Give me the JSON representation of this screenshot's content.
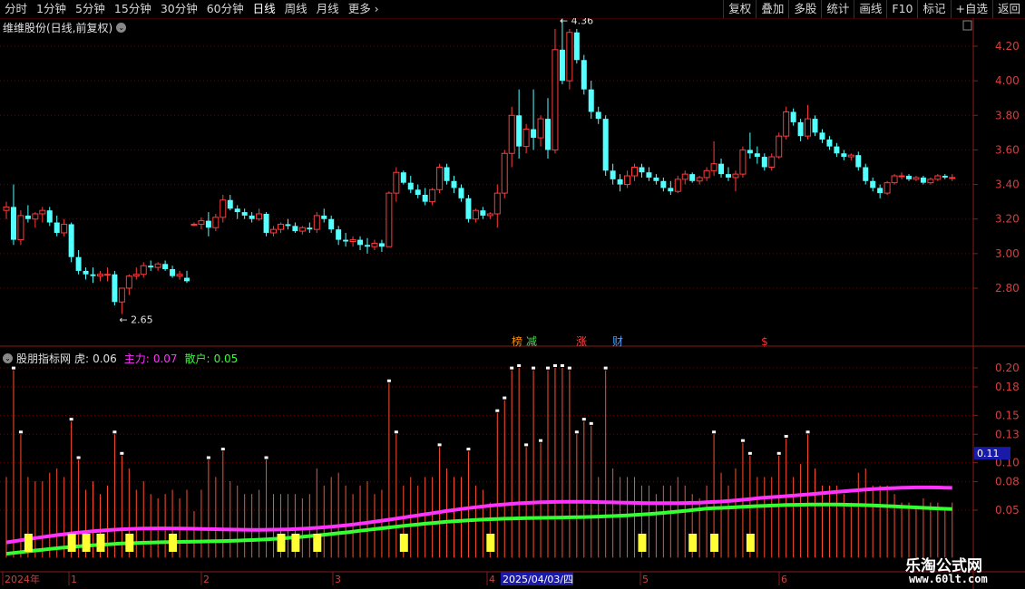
{
  "toolbar": {
    "periods": [
      "分时",
      "1分钟",
      "5分钟",
      "15分钟",
      "30分钟",
      "60分钟",
      "日线",
      "周线",
      "月线",
      "更多"
    ],
    "active_period": "日线",
    "right_buttons": [
      "复权",
      "叠加",
      "多股",
      "统计",
      "画线",
      "F10",
      "标记",
      "+自选",
      "返回"
    ]
  },
  "price_panel": {
    "title": "维维股份(日线,前复权)",
    "high_label": "4.36",
    "low_label": "2.65",
    "y_ticks": [
      "4.20",
      "4.00",
      "3.80",
      "3.60",
      "3.40",
      "3.20",
      "3.00",
      "2.80"
    ],
    "markers": [
      {
        "text": "榜",
        "color": "#ff8c00"
      },
      {
        "text": "减",
        "color": "#4cd94c"
      },
      {
        "text": "涨",
        "color": "#ff4040"
      },
      {
        "text": "财",
        "color": "#4a9eff"
      },
      {
        "text": "$",
        "color": "#ff3030"
      }
    ]
  },
  "indicator_panel": {
    "name": "股朋指标网",
    "label_tiger": "虎:",
    "value_tiger": "0.06",
    "label_main": "主力:",
    "value_main": "0.07",
    "label_retail": "散户:",
    "value_retail": "0.05",
    "y_ticks": [
      "0.20",
      "0.18",
      "0.15",
      "0.13",
      "0.10",
      "0.08",
      "0.05"
    ],
    "current_value": "0.11",
    "colors": {
      "main": "#ff33ff",
      "retail": "#33ff33",
      "bars": "#ff4d2e",
      "signal": "#ffff33"
    }
  },
  "date_axis": {
    "labels": [
      "2024年",
      "1",
      "2",
      "3",
      "4",
      "5",
      "6"
    ],
    "highlight": "2025/04/03/四"
  },
  "watermark": {
    "line1": "乐淘公式网",
    "line2": "www.60lt.com"
  },
  "chart_data": {
    "type": "candlestick",
    "title": "维维股份(日线,前复权)",
    "ylim": [
      2.6,
      4.4
    ],
    "candles": [
      [
        3.25,
        3.3,
        3.2,
        3.27
      ],
      [
        3.27,
        3.4,
        3.05,
        3.08
      ],
      [
        3.08,
        3.25,
        3.05,
        3.22
      ],
      [
        3.22,
        3.28,
        3.18,
        3.2
      ],
      [
        3.2,
        3.24,
        3.15,
        3.23
      ],
      [
        3.23,
        3.27,
        3.18,
        3.25
      ],
      [
        3.25,
        3.27,
        3.16,
        3.18
      ],
      [
        3.18,
        3.22,
        3.1,
        3.12
      ],
      [
        3.12,
        3.2,
        3.1,
        3.17
      ],
      [
        3.17,
        3.18,
        2.95,
        2.98
      ],
      [
        2.98,
        3.02,
        2.88,
        2.9
      ],
      [
        2.9,
        2.92,
        2.85,
        2.88
      ],
      [
        2.88,
        2.92,
        2.83,
        2.87
      ],
      [
        2.87,
        2.9,
        2.84,
        2.88
      ],
      [
        2.88,
        2.92,
        2.84,
        2.88
      ],
      [
        2.88,
        2.9,
        2.7,
        2.72
      ],
      [
        2.72,
        2.8,
        2.65,
        2.8
      ],
      [
        2.8,
        2.88,
        2.76,
        2.87
      ],
      [
        2.87,
        2.92,
        2.85,
        2.88
      ],
      [
        2.88,
        2.95,
        2.86,
        2.93
      ],
      [
        2.93,
        2.96,
        2.9,
        2.92
      ],
      [
        2.92,
        2.95,
        2.9,
        2.94
      ],
      [
        2.94,
        2.96,
        2.9,
        2.91
      ],
      [
        2.91,
        2.93,
        2.86,
        2.87
      ],
      [
        2.87,
        2.9,
        2.85,
        2.88
      ],
      [
        2.86,
        2.9,
        2.83,
        2.84
      ],
      [
        3.17,
        3.18,
        3.16,
        3.17
      ],
      [
        3.17,
        3.21,
        3.14,
        3.19
      ],
      [
        3.19,
        3.24,
        3.1,
        3.15
      ],
      [
        3.15,
        3.23,
        3.13,
        3.21
      ],
      [
        3.21,
        3.34,
        3.18,
        3.31
      ],
      [
        3.31,
        3.34,
        3.25,
        3.26
      ],
      [
        3.26,
        3.28,
        3.2,
        3.24
      ],
      [
        3.24,
        3.26,
        3.2,
        3.22
      ],
      [
        3.22,
        3.24,
        3.18,
        3.2
      ],
      [
        3.2,
        3.26,
        3.19,
        3.23
      ],
      [
        3.23,
        3.24,
        3.1,
        3.12
      ],
      [
        3.12,
        3.16,
        3.1,
        3.14
      ],
      [
        3.14,
        3.18,
        3.12,
        3.17
      ],
      [
        3.17,
        3.2,
        3.14,
        3.16
      ],
      [
        3.16,
        3.18,
        3.12,
        3.13
      ],
      [
        3.13,
        3.16,
        3.11,
        3.15
      ],
      [
        3.15,
        3.18,
        3.12,
        3.14
      ],
      [
        3.14,
        3.24,
        3.12,
        3.22
      ],
      [
        3.22,
        3.26,
        3.18,
        3.2
      ],
      [
        3.2,
        3.22,
        3.12,
        3.14
      ],
      [
        3.14,
        3.16,
        3.05,
        3.08
      ],
      [
        3.08,
        3.12,
        3.04,
        3.07
      ],
      [
        3.07,
        3.1,
        3.04,
        3.08
      ],
      [
        3.08,
        3.1,
        3.02,
        3.05
      ],
      [
        3.05,
        3.09,
        3.0,
        3.04
      ],
      [
        3.04,
        3.08,
        3.02,
        3.06
      ],
      [
        3.06,
        3.08,
        3.01,
        3.04
      ],
      [
        3.04,
        3.36,
        3.04,
        3.35
      ],
      [
        3.35,
        3.5,
        3.3,
        3.47
      ],
      [
        3.47,
        3.48,
        3.4,
        3.41
      ],
      [
        3.41,
        3.45,
        3.35,
        3.37
      ],
      [
        3.37,
        3.4,
        3.32,
        3.34
      ],
      [
        3.34,
        3.38,
        3.28,
        3.3
      ],
      [
        3.3,
        3.38,
        3.28,
        3.37
      ],
      [
        3.37,
        3.52,
        3.35,
        3.5
      ],
      [
        3.5,
        3.52,
        3.4,
        3.42
      ],
      [
        3.42,
        3.45,
        3.35,
        3.38
      ],
      [
        3.38,
        3.4,
        3.3,
        3.32
      ],
      [
        3.32,
        3.34,
        3.18,
        3.2
      ],
      [
        3.2,
        3.26,
        3.18,
        3.25
      ],
      [
        3.25,
        3.27,
        3.2,
        3.22
      ],
      [
        3.22,
        3.24,
        3.2,
        3.23
      ],
      [
        3.23,
        3.4,
        3.15,
        3.35
      ],
      [
        3.35,
        3.6,
        3.32,
        3.58
      ],
      [
        3.58,
        3.85,
        3.5,
        3.8
      ],
      [
        3.8,
        3.95,
        3.55,
        3.62
      ],
      [
        3.62,
        3.75,
        3.58,
        3.72
      ],
      [
        3.72,
        3.95,
        3.6,
        3.67
      ],
      [
        3.67,
        3.8,
        3.62,
        3.78
      ],
      [
        3.78,
        3.9,
        3.55,
        3.6
      ],
      [
        3.6,
        4.3,
        3.58,
        4.18
      ],
      [
        4.18,
        4.36,
        3.98,
        4.0
      ],
      [
        4.0,
        4.3,
        3.95,
        4.28
      ],
      [
        4.28,
        4.3,
        4.1,
        4.12
      ],
      [
        4.12,
        4.15,
        3.92,
        3.95
      ],
      [
        3.95,
        4.0,
        3.78,
        3.82
      ],
      [
        3.82,
        3.85,
        3.75,
        3.78
      ],
      [
        3.78,
        3.8,
        3.45,
        3.48
      ],
      [
        3.48,
        3.52,
        3.4,
        3.43
      ],
      [
        3.43,
        3.46,
        3.36,
        3.4
      ],
      [
        3.4,
        3.48,
        3.38,
        3.45
      ],
      [
        3.45,
        3.52,
        3.42,
        3.5
      ],
      [
        3.5,
        3.52,
        3.44,
        3.47
      ],
      [
        3.47,
        3.5,
        3.42,
        3.44
      ],
      [
        3.44,
        3.46,
        3.4,
        3.42
      ],
      [
        3.42,
        3.44,
        3.36,
        3.38
      ],
      [
        3.38,
        3.42,
        3.34,
        3.36
      ],
      [
        3.36,
        3.45,
        3.35,
        3.43
      ],
      [
        3.43,
        3.48,
        3.4,
        3.46
      ],
      [
        3.46,
        3.47,
        3.41,
        3.42
      ],
      [
        3.42,
        3.45,
        3.4,
        3.44
      ],
      [
        3.44,
        3.5,
        3.42,
        3.48
      ],
      [
        3.48,
        3.65,
        3.45,
        3.52
      ],
      [
        3.52,
        3.55,
        3.44,
        3.46
      ],
      [
        3.46,
        3.5,
        3.42,
        3.44
      ],
      [
        3.44,
        3.48,
        3.36,
        3.46
      ],
      [
        3.46,
        3.62,
        3.44,
        3.6
      ],
      [
        3.6,
        3.7,
        3.55,
        3.58
      ],
      [
        3.58,
        3.62,
        3.52,
        3.56
      ],
      [
        3.56,
        3.58,
        3.48,
        3.5
      ],
      [
        3.5,
        3.58,
        3.48,
        3.56
      ],
      [
        3.56,
        3.7,
        3.55,
        3.68
      ],
      [
        3.68,
        3.85,
        3.66,
        3.82
      ],
      [
        3.82,
        3.84,
        3.74,
        3.76
      ],
      [
        3.76,
        3.78,
        3.65,
        3.68
      ],
      [
        3.68,
        3.86,
        3.66,
        3.78
      ],
      [
        3.78,
        3.8,
        3.68,
        3.7
      ],
      [
        3.7,
        3.72,
        3.64,
        3.66
      ],
      [
        3.66,
        3.68,
        3.6,
        3.62
      ],
      [
        3.62,
        3.64,
        3.56,
        3.58
      ],
      [
        3.58,
        3.6,
        3.54,
        3.56
      ],
      [
        3.56,
        3.58,
        3.54,
        3.57
      ],
      [
        3.57,
        3.59,
        3.48,
        3.5
      ],
      [
        3.5,
        3.52,
        3.4,
        3.42
      ],
      [
        3.42,
        3.44,
        3.36,
        3.38
      ],
      [
        3.38,
        3.4,
        3.32,
        3.35
      ],
      [
        3.35,
        3.42,
        3.34,
        3.41
      ],
      [
        3.41,
        3.46,
        3.4,
        3.45
      ],
      [
        3.45,
        3.47,
        3.43,
        3.45
      ],
      [
        3.45,
        3.46,
        3.42,
        3.43
      ],
      [
        3.43,
        3.45,
        3.42,
        3.44
      ],
      [
        3.44,
        3.45,
        3.4,
        3.41
      ],
      [
        3.41,
        3.44,
        3.4,
        3.43
      ],
      [
        3.43,
        3.46,
        3.42,
        3.45
      ],
      [
        3.45,
        3.46,
        3.43,
        3.44
      ],
      [
        3.44,
        3.46,
        3.42,
        3.44
      ]
    ]
  }
}
